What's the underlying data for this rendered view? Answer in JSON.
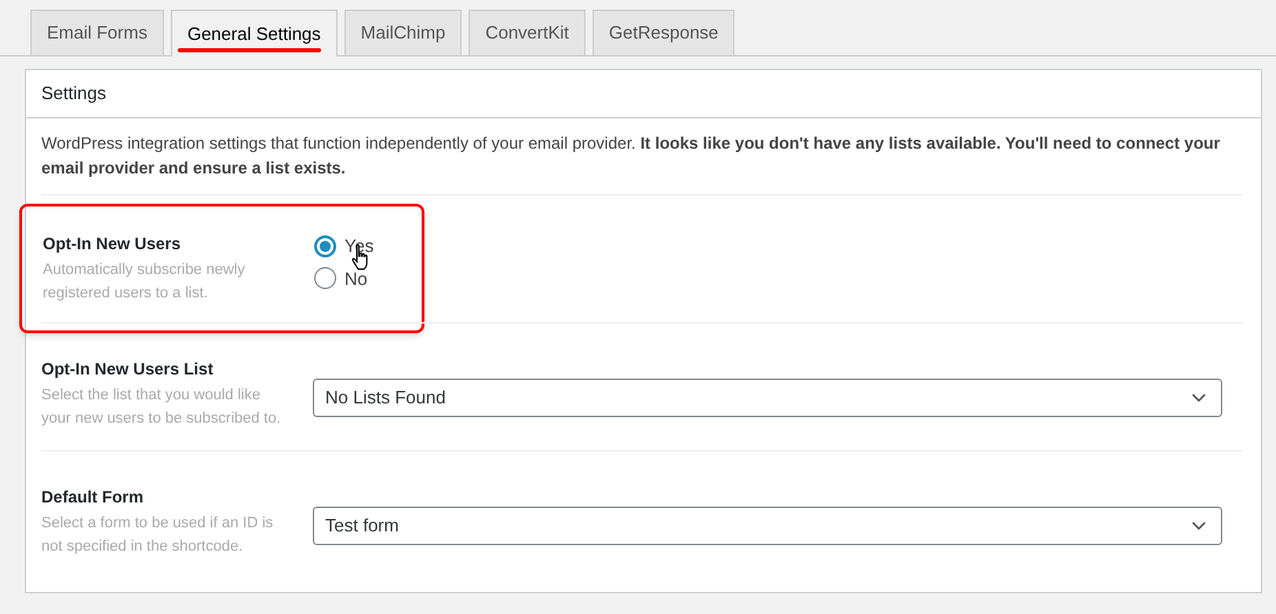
{
  "tabs": [
    {
      "label": "Email Forms",
      "selected": false
    },
    {
      "label": "General Settings",
      "selected": true
    },
    {
      "label": "MailChimp",
      "selected": false
    },
    {
      "label": "ConvertKit",
      "selected": false
    },
    {
      "label": "GetResponse",
      "selected": false
    }
  ],
  "panel": {
    "title": "Settings",
    "description": "WordPress integration settings that function independently of your email provider. **It looks like you don't have any lists available. You'll need to connect your email provider and ensure a list exists.**"
  },
  "settings": [
    {
      "kind": "radio",
      "label": "Opt-In New Users",
      "help": "Automatically subscribe newly registered users to a list.",
      "highlighted": true,
      "options": [
        {
          "label": "Yes",
          "selected": true
        },
        {
          "label": "No",
          "selected": false
        }
      ]
    },
    {
      "kind": "select",
      "label": "Opt-In New Users List",
      "help": "Select the list that you would like your new users to be subscribed to.",
      "value": "No Lists Found"
    },
    {
      "kind": "select",
      "label": "Default Form",
      "help": "Select a form to be used if an ID is not specified in the shortcode.",
      "value": "Test form"
    }
  ]
}
